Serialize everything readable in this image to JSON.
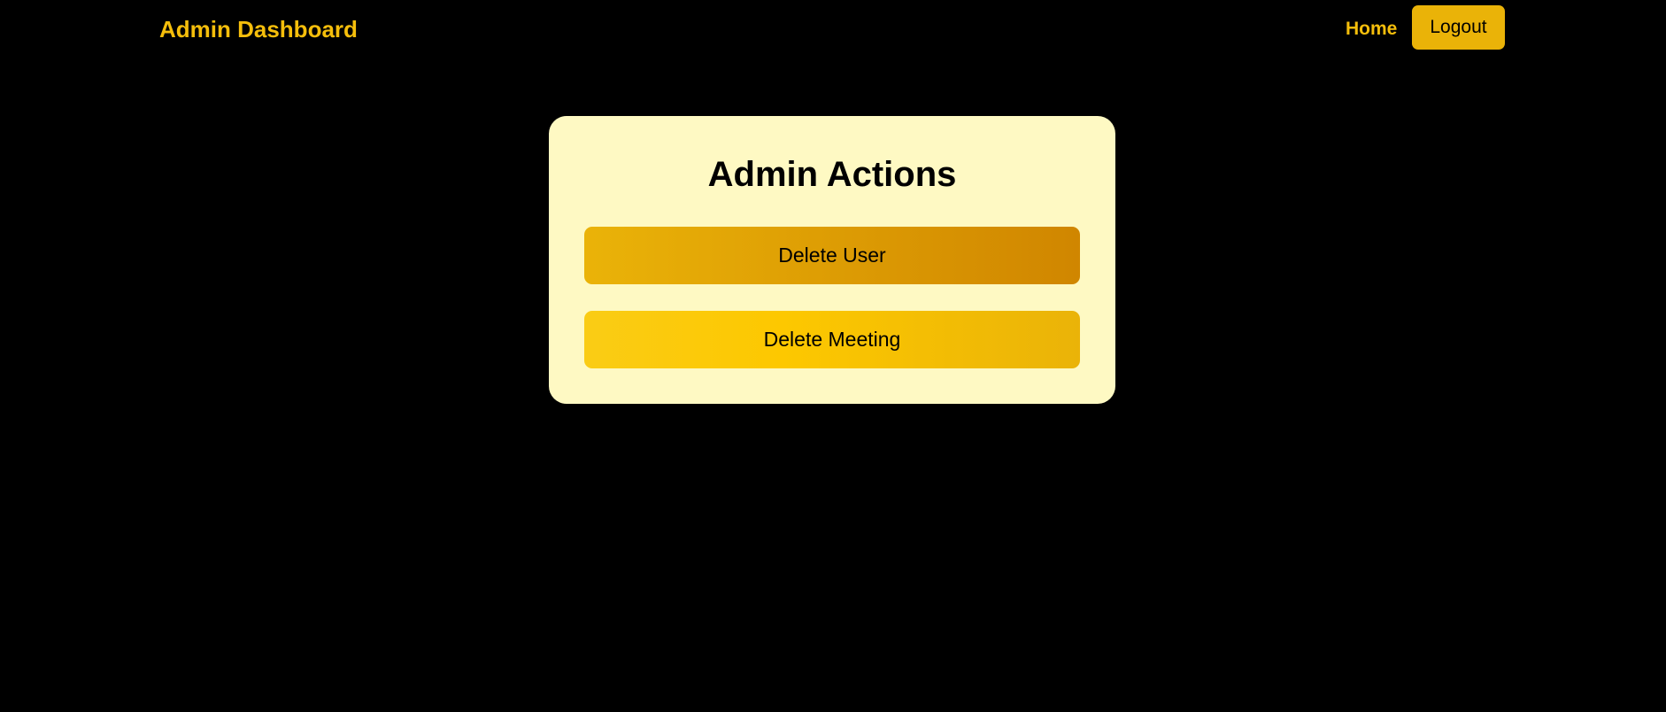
{
  "navbar": {
    "brand": "Admin Dashboard",
    "home_label": "Home",
    "logout_label": "Logout"
  },
  "card": {
    "title": "Admin Actions",
    "buttons": [
      {
        "label": "Delete User"
      },
      {
        "label": "Delete Meeting"
      }
    ]
  },
  "colors": {
    "background": "#000000",
    "accent": "#f5be0b",
    "card_background": "#fef9c3",
    "logout_button": "#eab308",
    "delete_user_gradient": [
      "#eab308",
      "#d08600"
    ],
    "delete_meeting_gradient": [
      "#facc15",
      "#eab308"
    ]
  }
}
